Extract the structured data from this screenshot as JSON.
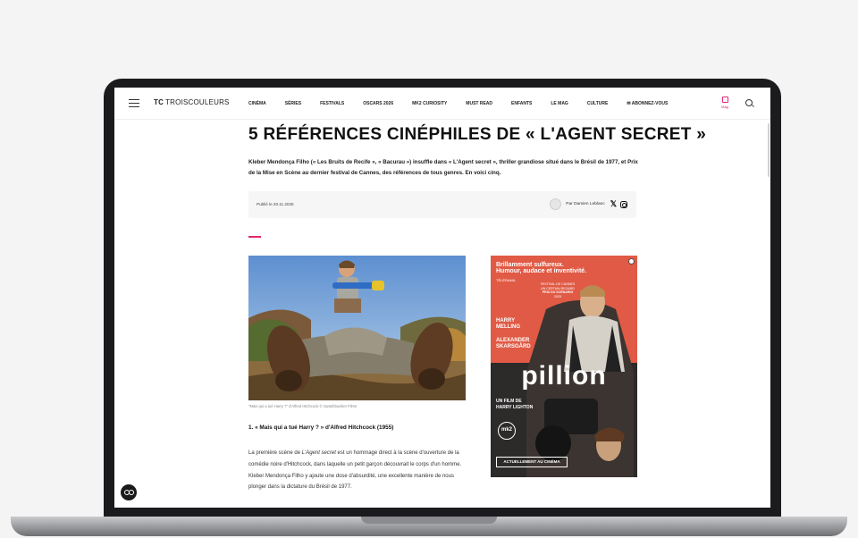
{
  "site": {
    "logo_mark": "TC",
    "logo_text": "TROISCOULEURS"
  },
  "nav": {
    "items": [
      "CINÉMA",
      "SÉRIES",
      "FESTIVALS",
      "OSCARS 2026",
      "MK2 CURIOSITY",
      "MUST READ",
      "ENFANTS",
      "LE MAG",
      "CULTURE",
      "ABONNEZ-VOUS"
    ],
    "mag_label": "Mag",
    "icons": {
      "menu": "hamburger-icon",
      "cart": "bag-icon",
      "search": "search-icon"
    }
  },
  "article": {
    "title": "5 RÉFÉRENCES CINÉPHILES DE « L'AGENT SECRET »",
    "lead": "Kleber Mendonça Filho (« Les Bruits de Recife », « Bacurau ») insuffle dans « L'Agent secret », thriller grandiose situé dans le Brésil de 1977, et Prix de la Mise en Scène au dernier festival de Cannes, des références de tous genres. En voici cinq.",
    "published": "Publié le 20.11.2025",
    "author": "Par Damien Leblanc",
    "photo_caption": "\"Mais qui a tué Harry ?\" d'Alfred Hitchcock © Swashbuckler Films",
    "section_heading": "1. « Mais qui a tué Harry ? » d'Alfred Hitchcock (1955)",
    "body_pre": "La première scène de ",
    "body_em": "L'Agent secret",
    "body_post": " est un hommage direct à la scène d'ouverture de la comédie noire d'Hitchcock, dans laquelle un petit garçon découvrait le corps d'un homme. Kleber Mendonça Filho y ajoute une dose d'absurdité, une excellente manière de nous plonger dans la dictature du Brésil de 1977."
  },
  "ad": {
    "press_quote_1": "Brillamment sulfureux.",
    "press_quote_2": "Humour, audace et inventivité.",
    "press_source": "TÉLÉRAMA",
    "festival": "FESTIVAL DE CANNES",
    "festival_section": "UN CERTAIN REGARD",
    "prize": "PRIX DU SCÉNARIO",
    "year": "2025",
    "cast_1a": "HARRY",
    "cast_1b": "MELLING",
    "cast_2a": "ALEXANDER",
    "cast_2b": "SKARSGÅRD",
    "film_title": "pillion",
    "director_line_1": "UN FILM DE",
    "director_line_2": "HARRY LIGHTON",
    "distributor": "mk2",
    "now_showing": "ACTUELLEMENT AU CINÉMA"
  },
  "colors": {
    "accent": "#e5276f",
    "poster_bg": "#e05a45"
  }
}
